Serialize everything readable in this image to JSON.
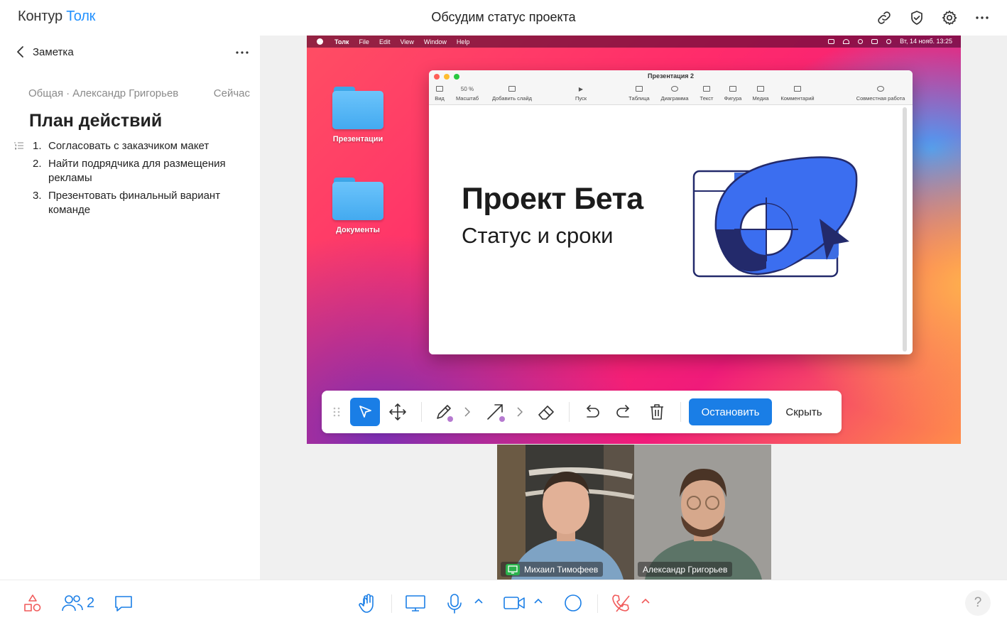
{
  "app": {
    "brand_primary": "Контур",
    "brand_secondary": "Толк",
    "meeting_title": "Обсудим статус проекта",
    "accent_color": "#1a7ee6",
    "danger_color": "#f15a5a"
  },
  "top_actions": [
    "link-icon",
    "shield-check-icon",
    "gear-icon",
    "more-icon"
  ],
  "note": {
    "back_label": "Заметка",
    "category": "Общая",
    "separator": "·",
    "author": "Александр Григорьев",
    "time": "Сейчас",
    "heading": "План действий",
    "items": [
      {
        "num": "1.",
        "text": "Согласовать с заказчиком макет"
      },
      {
        "num": "2.",
        "text": "Найти подрядчика для размещения рекламы"
      },
      {
        "num": "3.",
        "text": "Презентовать финальный вариант команде"
      }
    ]
  },
  "screen": {
    "menubar": {
      "app": "Толк",
      "menus": [
        "File",
        "Edit",
        "View",
        "Window",
        "Help"
      ],
      "clock": "Вт, 14 нояб.  13:25"
    },
    "desktop_folders": [
      "Презентации",
      "Документы"
    ],
    "keynote": {
      "window_title": "Презентация 2",
      "zoom_value": "50 %",
      "toolbar": [
        "Вид",
        "Масштаб",
        "Добавить слайд",
        "Пуск",
        "Таблица",
        "Диаграмма",
        "Текст",
        "Фигура",
        "Медиа",
        "Комментарий",
        "Совместная работа"
      ],
      "slide_title": "Проект Бета",
      "slide_subtitle": "Статус и сроки"
    }
  },
  "annotation_toolbar": {
    "tools": [
      "drag-handle-icon",
      "select-pointer-icon",
      "move-icon",
      "pen-icon",
      "arrow-icon",
      "eraser-icon",
      "undo-icon",
      "redo-icon",
      "trash-icon"
    ],
    "pen_color": "#b67ad0",
    "stop_label": "Остановить",
    "hide_label": "Скрыть"
  },
  "participants": [
    {
      "name": "Михаил Тимофеев",
      "sharing": true
    },
    {
      "name": "Александр Григорьев",
      "sharing": false
    }
  ],
  "bottom_bar": {
    "participants_count": "2",
    "help_label": "?"
  }
}
